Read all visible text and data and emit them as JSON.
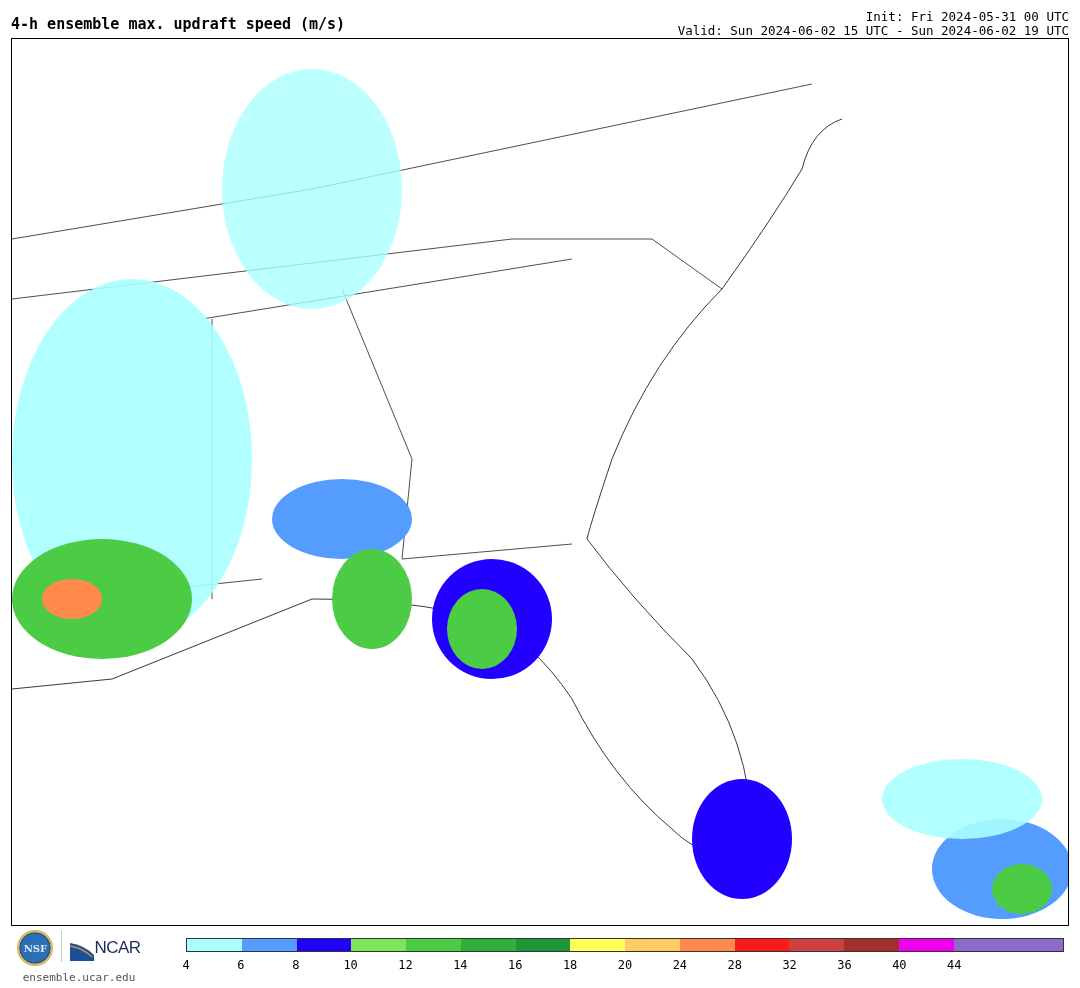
{
  "header": {
    "title": "4-h ensemble max. updraft speed (m/s)",
    "init": "Init: Fri 2024-05-31 00 UTC",
    "valid": "Valid: Sun 2024-06-02 15 UTC - Sun 2024-06-02 19 UTC"
  },
  "footer": {
    "nsf_logo_text": "NSF",
    "ncar_logo_text": "NCAR",
    "site": "ensemble.ucar.edu"
  },
  "colorbar": {
    "bins": [
      {
        "color": "#aaffff",
        "label": "4"
      },
      {
        "color": "#559cff",
        "label": "6"
      },
      {
        "color": "#2200ff",
        "label": "8"
      },
      {
        "color": "#7be65a",
        "label": "10"
      },
      {
        "color": "#4ccb45",
        "label": "12"
      },
      {
        "color": "#30b03a",
        "label": "14"
      },
      {
        "color": "#1e9638",
        "label": "16"
      },
      {
        "color": "#ffff5a",
        "label": "18"
      },
      {
        "color": "#ffcc66",
        "label": "20"
      },
      {
        "color": "#ff8a4c",
        "label": "24"
      },
      {
        "color": "#ff1a1a",
        "label": "28"
      },
      {
        "color": "#cc4040",
        "label": "32"
      },
      {
        "color": "#a52e2e",
        "label": "36"
      },
      {
        "color": "#ee00ee",
        "label": "40"
      },
      {
        "color": "#8c6bcc",
        "label": "44"
      }
    ]
  }
}
